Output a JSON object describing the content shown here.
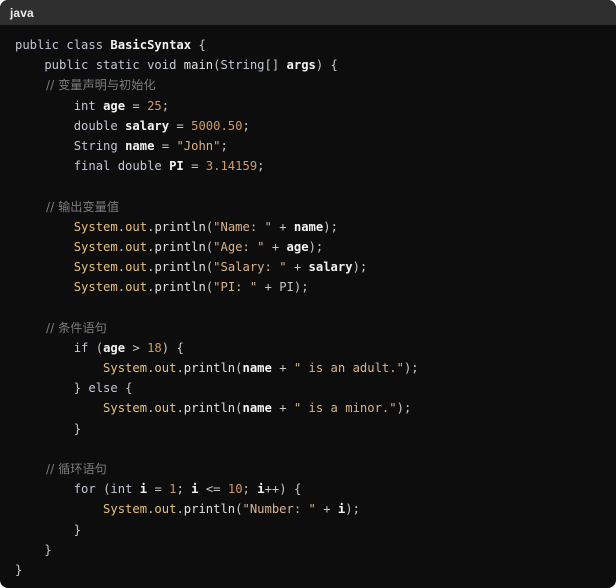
{
  "code_block": {
    "language": "java",
    "lines": [
      [
        [
          "kw",
          "public class "
        ],
        [
          "cls",
          "BasicSyntax"
        ],
        [
          "pun",
          " {"
        ]
      ],
      [
        [
          "kw",
          "    public static void "
        ],
        [
          "fn",
          "main"
        ],
        [
          "pun",
          "("
        ],
        [
          "kw",
          "String"
        ],
        [
          "pun",
          "[] "
        ],
        [
          "var",
          "args"
        ],
        [
          "pun",
          ") {"
        ]
      ],
      [
        [
          "cmt",
          "        // 变量声明与初始化"
        ]
      ],
      [
        [
          "kw",
          "        int "
        ],
        [
          "var",
          "age"
        ],
        [
          "op",
          " = "
        ],
        [
          "num",
          "25"
        ],
        [
          "pun",
          ";"
        ]
      ],
      [
        [
          "kw",
          "        double "
        ],
        [
          "var",
          "salary"
        ],
        [
          "op",
          " = "
        ],
        [
          "num",
          "5000.50"
        ],
        [
          "pun",
          ";"
        ]
      ],
      [
        [
          "kw",
          "        String "
        ],
        [
          "var",
          "name"
        ],
        [
          "op",
          " = "
        ],
        [
          "str",
          "\"John\""
        ],
        [
          "pun",
          ";"
        ]
      ],
      [
        [
          "kw",
          "        final double "
        ],
        [
          "var",
          "PI"
        ],
        [
          "op",
          " = "
        ],
        [
          "num",
          "3.14159"
        ],
        [
          "pun",
          ";"
        ]
      ],
      [],
      [
        [
          "cmt",
          "        // 输出变量值"
        ]
      ],
      [
        [
          "obj",
          "        System"
        ],
        [
          "pun",
          "."
        ],
        [
          "obj",
          "out"
        ],
        [
          "pun",
          "."
        ],
        [
          "fn",
          "println"
        ],
        [
          "pun",
          "("
        ],
        [
          "str",
          "\"Name: \""
        ],
        [
          "op",
          " + "
        ],
        [
          "var",
          "name"
        ],
        [
          "pun",
          ");"
        ]
      ],
      [
        [
          "obj",
          "        System"
        ],
        [
          "pun",
          "."
        ],
        [
          "obj",
          "out"
        ],
        [
          "pun",
          "."
        ],
        [
          "fn",
          "println"
        ],
        [
          "pun",
          "("
        ],
        [
          "str",
          "\"Age: \""
        ],
        [
          "op",
          " + "
        ],
        [
          "var",
          "age"
        ],
        [
          "pun",
          ");"
        ]
      ],
      [
        [
          "obj",
          "        System"
        ],
        [
          "pun",
          "."
        ],
        [
          "obj",
          "out"
        ],
        [
          "pun",
          "."
        ],
        [
          "fn",
          "println"
        ],
        [
          "pun",
          "("
        ],
        [
          "str",
          "\"Salary: \""
        ],
        [
          "op",
          " + "
        ],
        [
          "var",
          "salary"
        ],
        [
          "pun",
          ");"
        ]
      ],
      [
        [
          "obj",
          "        System"
        ],
        [
          "pun",
          "."
        ],
        [
          "obj",
          "out"
        ],
        [
          "pun",
          "."
        ],
        [
          "fn",
          "println"
        ],
        [
          "pun",
          "("
        ],
        [
          "str",
          "\"PI: \""
        ],
        [
          "op",
          " + "
        ],
        [
          "pun",
          "PI);"
        ]
      ],
      [],
      [
        [
          "cmt",
          "        // 条件语句"
        ]
      ],
      [
        [
          "kw",
          "        if "
        ],
        [
          "pun",
          "("
        ],
        [
          "var",
          "age"
        ],
        [
          "op",
          " > "
        ],
        [
          "num",
          "18"
        ],
        [
          "pun",
          ") {"
        ]
      ],
      [
        [
          "obj",
          "            System"
        ],
        [
          "pun",
          "."
        ],
        [
          "obj",
          "out"
        ],
        [
          "pun",
          "."
        ],
        [
          "fn",
          "println"
        ],
        [
          "pun",
          "("
        ],
        [
          "var",
          "name"
        ],
        [
          "op",
          " + "
        ],
        [
          "str",
          "\" is an adult.\""
        ],
        [
          "pun",
          ");"
        ]
      ],
      [
        [
          "pun",
          "        } "
        ],
        [
          "kw",
          "else"
        ],
        [
          "pun",
          " {"
        ]
      ],
      [
        [
          "obj",
          "            System"
        ],
        [
          "pun",
          "."
        ],
        [
          "obj",
          "out"
        ],
        [
          "pun",
          "."
        ],
        [
          "fn",
          "println"
        ],
        [
          "pun",
          "("
        ],
        [
          "var",
          "name"
        ],
        [
          "op",
          " + "
        ],
        [
          "str",
          "\" is a minor.\""
        ],
        [
          "pun",
          ");"
        ]
      ],
      [
        [
          "pun",
          "        }"
        ]
      ],
      [],
      [
        [
          "cmt",
          "        // 循环语句"
        ]
      ],
      [
        [
          "kw",
          "        for "
        ],
        [
          "pun",
          "("
        ],
        [
          "kw",
          "int "
        ],
        [
          "var",
          "i"
        ],
        [
          "op",
          " = "
        ],
        [
          "num",
          "1"
        ],
        [
          "pun",
          "; "
        ],
        [
          "var",
          "i"
        ],
        [
          "op",
          " <= "
        ],
        [
          "num",
          "10"
        ],
        [
          "pun",
          "; "
        ],
        [
          "var",
          "i"
        ],
        [
          "op",
          "++"
        ],
        [
          "pun",
          ") {"
        ]
      ],
      [
        [
          "obj",
          "            System"
        ],
        [
          "pun",
          "."
        ],
        [
          "obj",
          "out"
        ],
        [
          "pun",
          "."
        ],
        [
          "fn",
          "println"
        ],
        [
          "pun",
          "("
        ],
        [
          "str",
          "\"Number: \""
        ],
        [
          "op",
          " + "
        ],
        [
          "var",
          "i"
        ],
        [
          "pun",
          ");"
        ]
      ],
      [
        [
          "pun",
          "        }"
        ]
      ],
      [
        [
          "pun",
          "    }"
        ]
      ],
      [
        [
          "pun",
          "}"
        ]
      ]
    ]
  }
}
